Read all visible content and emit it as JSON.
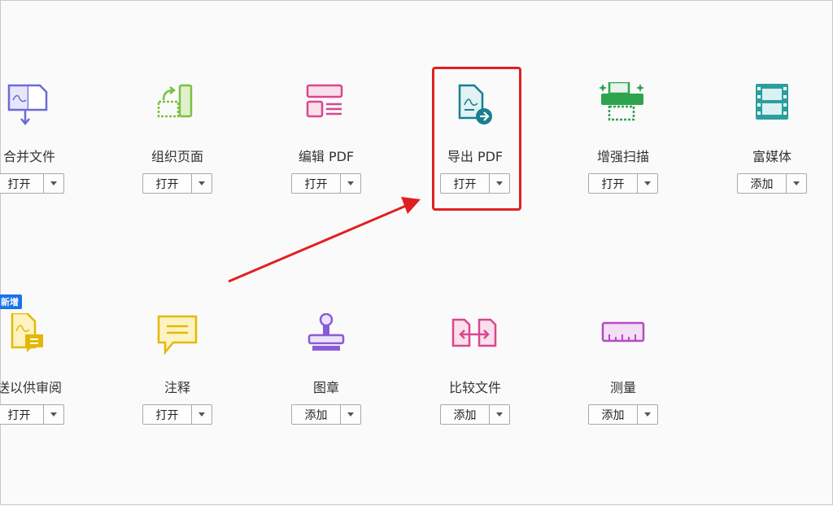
{
  "tools": [
    {
      "id": "combine",
      "label": "合并文件",
      "action": "打开",
      "icon": "combine-files-icon",
      "color": "#6b6bd6"
    },
    {
      "id": "organize",
      "label": "组织页面",
      "action": "打开",
      "icon": "organize-pages-icon",
      "color": "#7ac142"
    },
    {
      "id": "edit",
      "label": "编辑 PDF",
      "action": "打开",
      "icon": "edit-pdf-icon",
      "color": "#d9478f"
    },
    {
      "id": "export",
      "label": "导出 PDF",
      "action": "打开",
      "icon": "export-pdf-icon",
      "color": "#17808f"
    },
    {
      "id": "enhance",
      "label": "增强扫描",
      "action": "打开",
      "icon": "enhance-scan-icon",
      "color": "#2ea44f"
    },
    {
      "id": "media",
      "label": "富媒体",
      "action": "添加",
      "icon": "rich-media-icon",
      "color": "#2b9e9e"
    },
    {
      "id": "review",
      "label": "送以供审阅",
      "action": "打开",
      "icon": "send-for-review-icon",
      "color": "#e5b800",
      "badge": "新增"
    },
    {
      "id": "comment",
      "label": "注释",
      "action": "打开",
      "icon": "comment-icon",
      "color": "#e5b800"
    },
    {
      "id": "stamp",
      "label": "图章",
      "action": "添加",
      "icon": "stamp-icon",
      "color": "#8a5bd6"
    },
    {
      "id": "compare",
      "label": "比较文件",
      "action": "添加",
      "icon": "compare-files-icon",
      "color": "#d9478f"
    },
    {
      "id": "measure",
      "label": "测量",
      "action": "添加",
      "icon": "measure-icon",
      "color": "#b44bc4"
    }
  ],
  "highlight_color": "#e02020"
}
